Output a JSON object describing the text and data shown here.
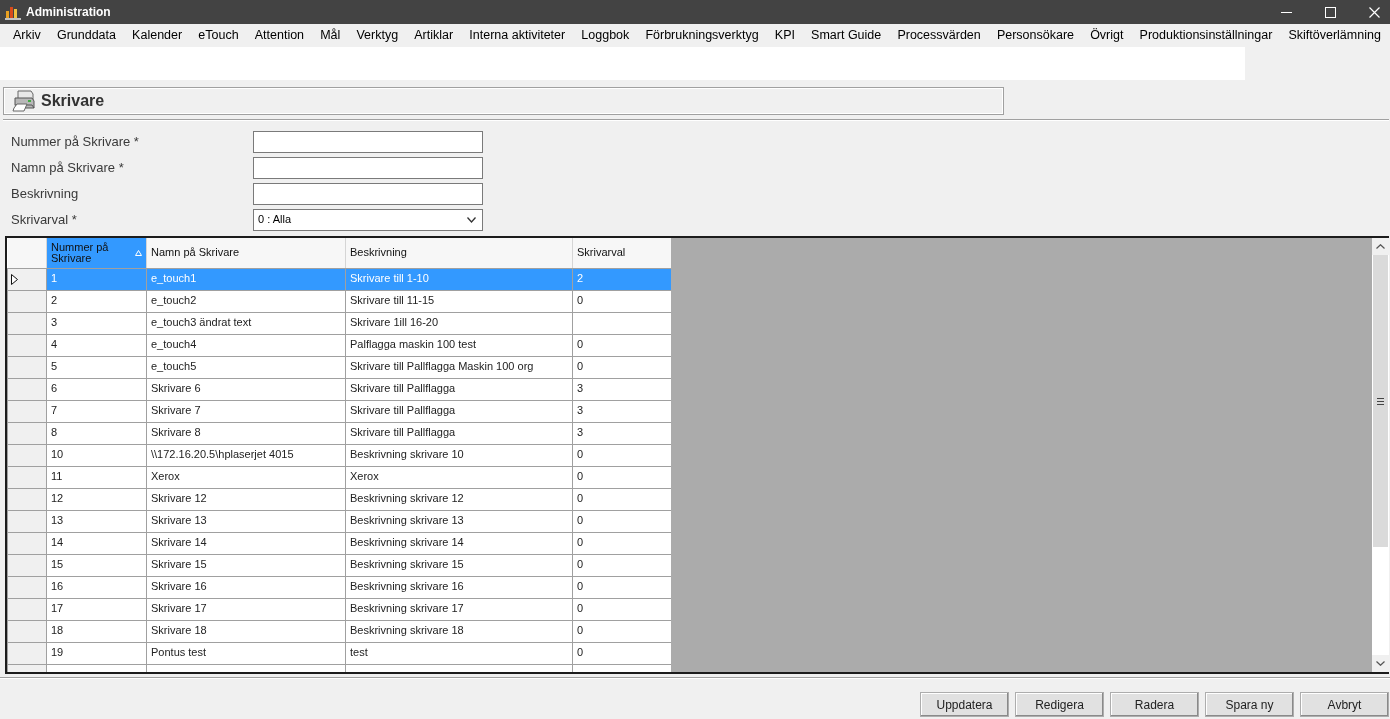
{
  "window": {
    "title": "Administration"
  },
  "menu": [
    "Arkiv",
    "Grunddata",
    "Kalender",
    "eTouch",
    "Attention",
    "Mål",
    "Verktyg",
    "Artiklar",
    "Interna aktiviteter",
    "Loggbok",
    "Förbrukningsverktyg",
    "KPI",
    "Smart Guide",
    "Processvärden",
    "Personsökare",
    "Övrigt",
    "Produktionsinställningar",
    "Skiftöverlämning"
  ],
  "section": {
    "title": "Skrivare"
  },
  "form": {
    "fields": [
      {
        "label": "Nummer på Skrivare *",
        "kind": "text"
      },
      {
        "label": "Namn på Skrivare *",
        "kind": "text"
      },
      {
        "label": "Beskrivning",
        "kind": "text"
      },
      {
        "label": "Skrivarval *",
        "kind": "dropdown",
        "value": "0 : Alla"
      }
    ]
  },
  "grid": {
    "columns": [
      {
        "label": "Nummer på Skrivare",
        "sorted": true
      },
      {
        "label": "Namn på Skrivare",
        "sorted": false
      },
      {
        "label": "Beskrivning",
        "sorted": false
      },
      {
        "label": "Skrivarval",
        "sorted": false
      }
    ],
    "rows": [
      {
        "selected": true,
        "nummer": "1",
        "namn": "e_touch1",
        "beskrivning": "Skrivare till 1-10",
        "skrivarval": "2"
      },
      {
        "selected": false,
        "nummer": "2",
        "namn": "e_touch2",
        "beskrivning": "Skrivare till 11-15",
        "skrivarval": "0"
      },
      {
        "selected": false,
        "nummer": "3",
        "namn": "e_touch3 ändrat text",
        "beskrivning": "Skrivare 1ill 16-20"
      },
      {
        "selected": false,
        "nummer": "4",
        "namn": "e_touch4",
        "beskrivning": "Palflagga maskin 100 test",
        "skrivarval": "0"
      },
      {
        "selected": false,
        "nummer": "5",
        "namn": "e_touch5",
        "beskrivning": "Skrivare till Pallflagga Maskin 100 org",
        "skrivarval": "0"
      },
      {
        "selected": false,
        "nummer": "6",
        "namn": "Skrivare 6",
        "beskrivning": "Skrivare till Pallflagga",
        "skrivarval": "3"
      },
      {
        "selected": false,
        "nummer": "7",
        "namn": "Skrivare 7",
        "beskrivning": "Skrivare till Pallflagga",
        "skrivarval": "3"
      },
      {
        "selected": false,
        "nummer": "8",
        "namn": "Skrivare 8",
        "beskrivning": "Skrivare till Pallflagga",
        "skrivarval": "3"
      },
      {
        "selected": false,
        "nummer": "10",
        "namn": "\\\\172.16.20.5\\hplaserjet 4015",
        "beskrivning": "Beskrivning skrivare 10",
        "skrivarval": "0"
      },
      {
        "selected": false,
        "nummer": "11",
        "namn": "Xerox",
        "beskrivning": "Xerox",
        "skrivarval": "0"
      },
      {
        "selected": false,
        "nummer": "12",
        "namn": "Skrivare 12",
        "beskrivning": "Beskrivning skrivare 12",
        "skrivarval": "0"
      },
      {
        "selected": false,
        "nummer": "13",
        "namn": "Skrivare 13",
        "beskrivning": "Beskrivning skrivare 13",
        "skrivarval": "0"
      },
      {
        "selected": false,
        "nummer": "14",
        "namn": "Skrivare 14",
        "beskrivning": "Beskrivning skrivare 14",
        "skrivarval": "0"
      },
      {
        "selected": false,
        "nummer": "15",
        "namn": "Skrivare 15",
        "beskrivning": "Beskrivning skrivare 15",
        "skrivarval": "0"
      },
      {
        "selected": false,
        "nummer": "16",
        "namn": "Skrivare 16",
        "beskrivning": "Beskrivning skrivare 16",
        "skrivarval": "0"
      },
      {
        "selected": false,
        "nummer": "17",
        "namn": "Skrivare 17",
        "beskrivning": "Beskrivning skrivare 17",
        "skrivarval": "0"
      },
      {
        "selected": false,
        "nummer": "18",
        "namn": "Skrivare 18",
        "beskrivning": "Beskrivning skrivare 18",
        "skrivarval": "0"
      },
      {
        "selected": false,
        "nummer": "19",
        "namn": "Pontus test",
        "beskrivning": "test",
        "skrivarval": "0"
      }
    ]
  },
  "buttons": [
    "Uppdatera",
    "Redigera",
    "Radera",
    "Spara ny",
    "Avbryt"
  ]
}
